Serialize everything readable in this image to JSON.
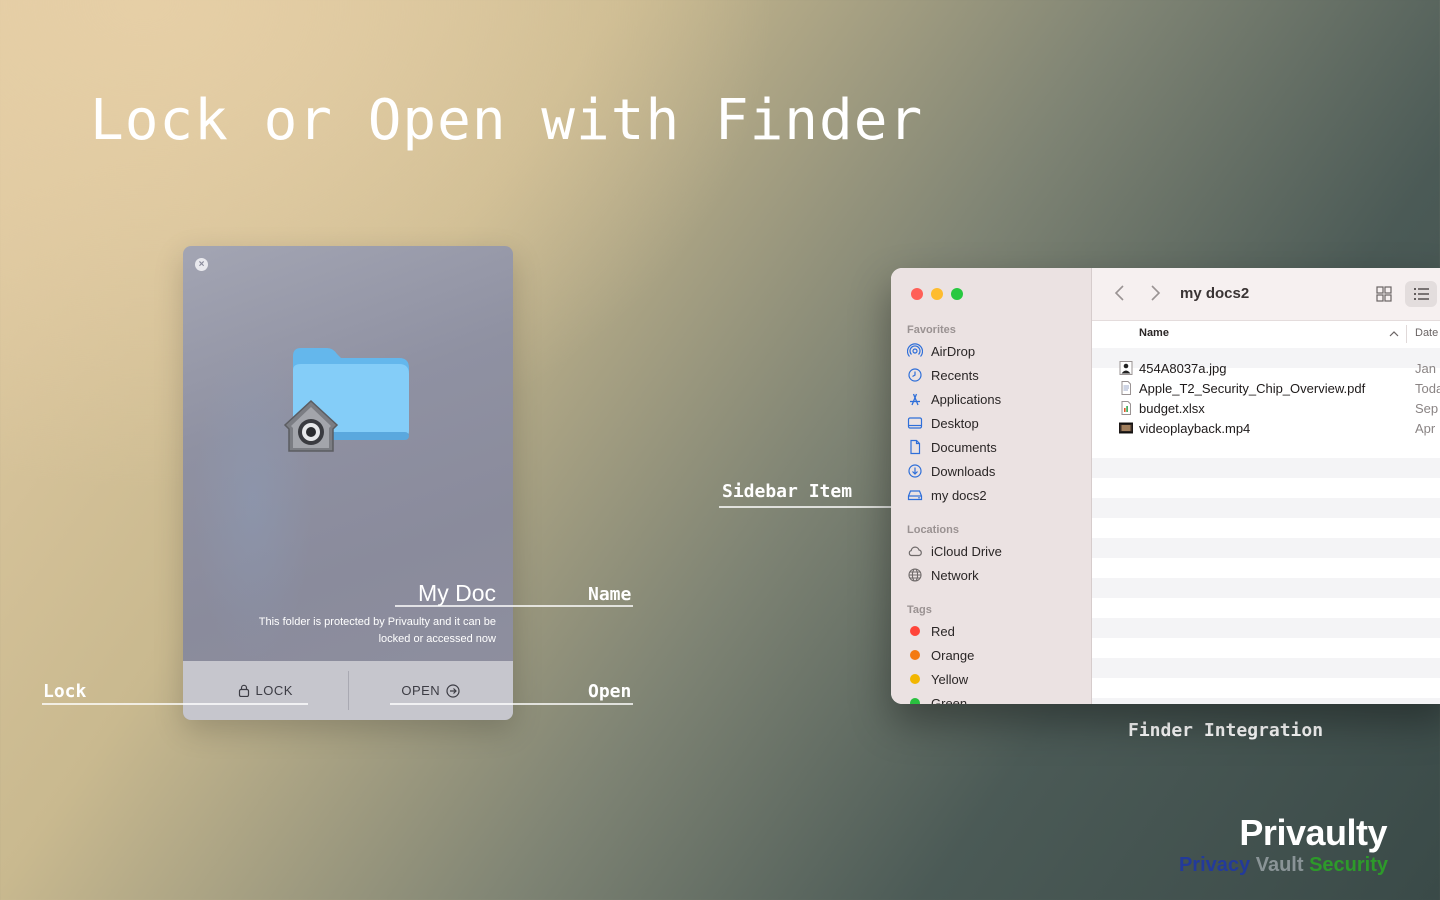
{
  "headline": "Lock or Open with Finder",
  "callouts": {
    "sidebar_item": "Sidebar Item",
    "name": "Name",
    "lock": "Lock",
    "open": "Open",
    "finder_integration": "Finder Integration"
  },
  "panel": {
    "doc_name": "My Doc",
    "description": "This folder is protected by Privaulty and it can be locked or accessed now",
    "lock_label": "LOCK",
    "open_label": "OPEN",
    "icons": {
      "close": "close-icon",
      "folder": "folder-icon",
      "lock_badge": "lock-badge-icon",
      "lock": "lock-icon",
      "open": "arrow-circle-right-icon"
    }
  },
  "finder": {
    "title": "my docs2",
    "sidebar": {
      "favorites_label": "Favorites",
      "favorites": [
        {
          "label": "AirDrop",
          "icon": "airdrop-icon"
        },
        {
          "label": "Recents",
          "icon": "clock-icon"
        },
        {
          "label": "Applications",
          "icon": "applications-icon"
        },
        {
          "label": "Desktop",
          "icon": "desktop-icon"
        },
        {
          "label": "Documents",
          "icon": "document-icon"
        },
        {
          "label": "Downloads",
          "icon": "download-icon"
        },
        {
          "label": "my docs2",
          "icon": "drive-icon"
        }
      ],
      "locations_label": "Locations",
      "locations": [
        {
          "label": "iCloud Drive",
          "icon": "cloud-icon"
        },
        {
          "label": "Network",
          "icon": "globe-icon"
        }
      ],
      "tags_label": "Tags",
      "tags": [
        {
          "label": "Red",
          "color": "#ff453a"
        },
        {
          "label": "Orange",
          "color": "#f47a12"
        },
        {
          "label": "Yellow",
          "color": "#f2b600"
        },
        {
          "label": "Green",
          "color": "#29c03f"
        }
      ]
    },
    "columns": {
      "name": "Name",
      "date": "Date"
    },
    "files": [
      {
        "name": "454A8037a.jpg",
        "date": "Jan",
        "icon": "image-file-icon"
      },
      {
        "name": "Apple_T2_Security_Chip_Overview.pdf",
        "date": "Toda",
        "icon": "pdf-file-icon"
      },
      {
        "name": "budget.xlsx",
        "date": "Sep",
        "icon": "spreadsheet-file-icon"
      },
      {
        "name": "videoplayback.mp4",
        "date": "Apr",
        "icon": "video-file-icon"
      }
    ]
  },
  "brand": {
    "name": "Privaulty",
    "tagline": {
      "privacy": "Privacy",
      "vault": "Vault",
      "security": "Security"
    },
    "colors": {
      "privacy": "#233a9a",
      "vault": "#8a9497",
      "security": "#2d9a2a"
    }
  },
  "colors": {
    "traffic_red": "#ff5f57",
    "traffic_yellow": "#febc2e",
    "traffic_green": "#28c840",
    "accent": "#2f6fd9"
  }
}
